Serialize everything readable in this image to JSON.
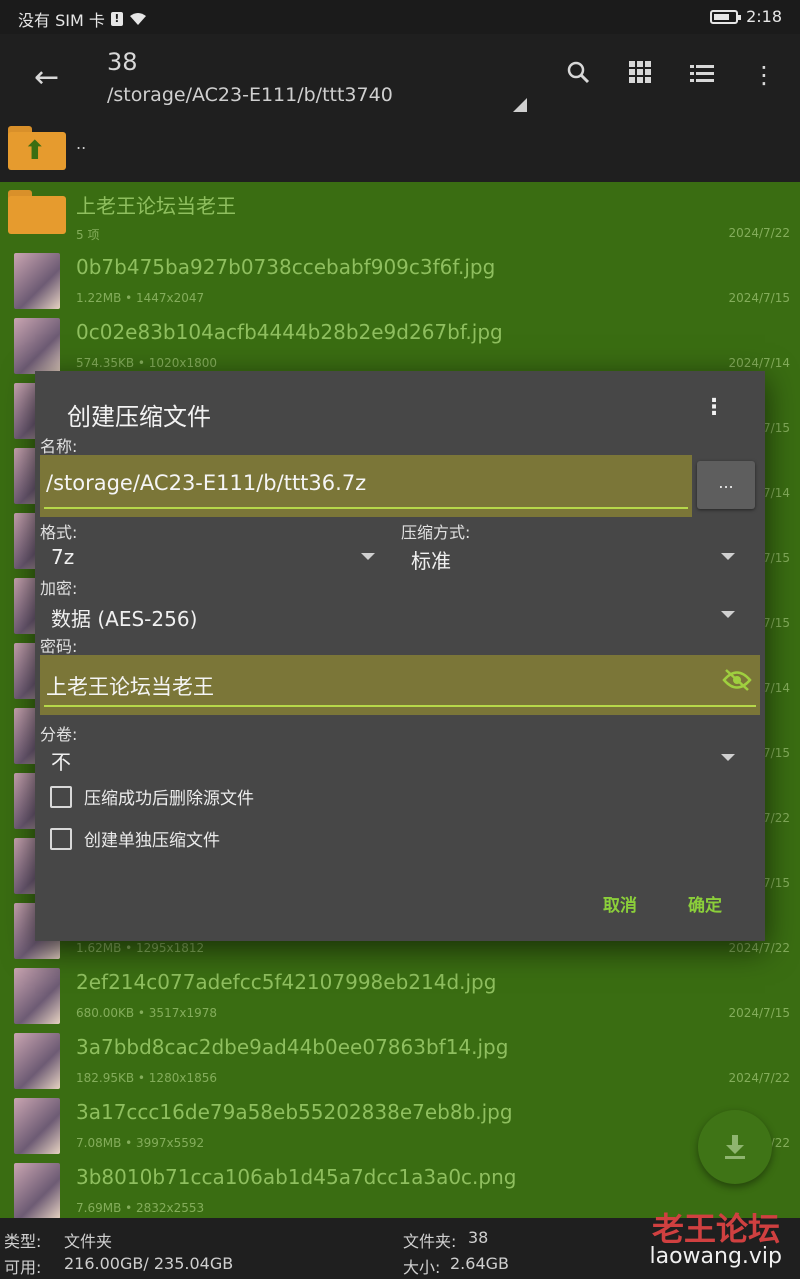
{
  "status_bar": {
    "carrier": "没有 SIM 卡",
    "sim_alert": "!",
    "time": "2:18",
    "wifi_icon": "wifi-icon",
    "battery_level": 0.75
  },
  "app_bar": {
    "title": "38",
    "path": "/storage/AC23-E111/b/ttt3740",
    "icons": [
      "back-arrow-icon",
      "search-icon",
      "grid-view-icon",
      "list-view-icon",
      "more-vert-icon"
    ]
  },
  "parent_row": {
    "label": ".."
  },
  "files": [
    {
      "name": "上老王论坛当老王",
      "meta": "5 项",
      "date": "2024/7/22",
      "type": "folder"
    },
    {
      "name": "0b7b475ba927b0738ccebabf909c3f6f.jpg",
      "meta": "1.22MB  • 1447x2047",
      "date": "2024/7/15"
    },
    {
      "name": "0c02e83b104acfb4444b28b2e9d267bf.jpg",
      "meta": "574.35KB  • 1020x1800",
      "date": "2024/7/14"
    },
    {
      "name": "",
      "meta": "",
      "date": "2024/7/15"
    },
    {
      "name": "",
      "meta": "",
      "date": "2024/7/14"
    },
    {
      "name": "",
      "meta": "",
      "date": "2024/7/15"
    },
    {
      "name": "",
      "meta": "",
      "date": "2024/7/15"
    },
    {
      "name": "",
      "meta": "",
      "date": "2024/7/14"
    },
    {
      "name": "",
      "meta": "",
      "date": "2024/7/15"
    },
    {
      "name": "",
      "meta": "",
      "date": "2024/7/22"
    },
    {
      "name": "",
      "meta": "",
      "date": "2024/7/15"
    },
    {
      "name": "",
      "meta": "1.62MB  • 1295x1812",
      "date": "2024/7/22"
    },
    {
      "name": "2ef214c077adefcc5f42107998eb214d.jpg",
      "meta": "680.00KB  • 3517x1978",
      "date": "2024/7/15"
    },
    {
      "name": "3a7bbd8cac2dbe9ad44b0ee07863bf14.jpg",
      "meta": "182.95KB  • 1280x1856",
      "date": "2024/7/22"
    },
    {
      "name": "3a17ccc16de79a58eb55202838e7eb8b.jpg",
      "meta": "7.08MB  • 3997x5592",
      "date": "2024/7/22"
    },
    {
      "name": "3b8010b71cca106ab1d45a7dcc1a3a0c.png",
      "meta": "7.69MB  • 2832x2553",
      "date": ""
    }
  ],
  "dialog": {
    "title": "创建压缩文件",
    "name_label": "名称:",
    "name_value": "/storage/AC23-E111/b/ttt36.7z",
    "browse_label": "...",
    "format_label": "格式:",
    "format_value": "7z",
    "compression_label": "压缩方式:",
    "compression_value": "标准",
    "encryption_label": "加密:",
    "encryption_value": "数据 (AES-256)",
    "password_label": "密码:",
    "password_value": "上老王论坛当老王",
    "split_label": "分卷:",
    "split_value": "不",
    "delete_source_label": "压缩成功后删除源文件",
    "delete_source_checked": false,
    "separate_label": "创建单独压缩文件",
    "separate_checked": false,
    "cancel_label": "取消",
    "ok_label": "确定"
  },
  "bottom_bar": {
    "type_label": "类型:",
    "type_value": "文件夹",
    "free_label": "可用:",
    "free_value": "216.00GB/ 235.04GB",
    "folder_label": "文件夹:",
    "folder_value": "38",
    "size_label": "大小:",
    "size_value": "2.64GB"
  },
  "watermark": {
    "brand": "老王论坛",
    "domain": "laowang.vip"
  },
  "colors": {
    "list_bg": "#3a6d12",
    "accent": "#8bcf3a",
    "dialog_bg": "#474747",
    "field_bg": "#7b7638"
  }
}
